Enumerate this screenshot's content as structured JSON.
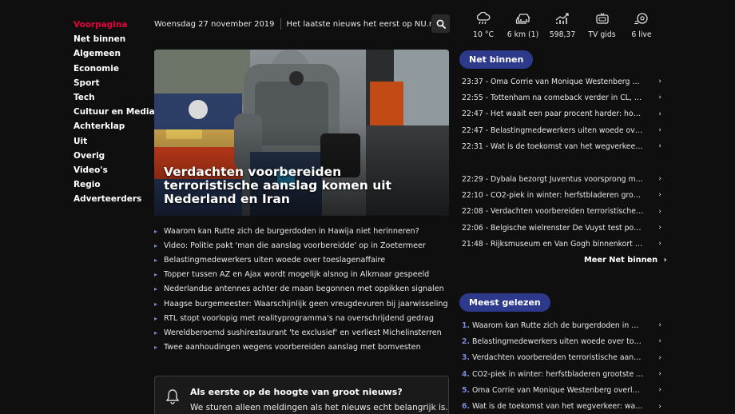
{
  "nav": {
    "items": [
      {
        "label": "Voorpagina",
        "active": true
      },
      {
        "label": "Net binnen",
        "active": false
      },
      {
        "label": "Algemeen",
        "active": false
      },
      {
        "label": "Economie",
        "active": false
      },
      {
        "label": "Sport",
        "active": false
      },
      {
        "label": "Tech",
        "active": false
      },
      {
        "label": "Cultuur en Media",
        "active": false
      },
      {
        "label": "Achterklap",
        "active": false
      },
      {
        "label": "Uit",
        "active": false
      },
      {
        "label": "Overig",
        "active": false
      },
      {
        "label": "Video's",
        "active": false
      },
      {
        "label": "Regio",
        "active": false
      },
      {
        "label": "Adverteerders",
        "active": false
      }
    ]
  },
  "topbar": {
    "date": "Woensdag 27 november 2019",
    "tagline": "Het laatste nieuws het eerst op NU.nl",
    "search_icon": "search-icon"
  },
  "widgets": [
    {
      "icon": "weather-rain-icon",
      "label": "10 °C"
    },
    {
      "icon": "traffic-car-icon",
      "label": "6 km (1)"
    },
    {
      "icon": "stock-chart-icon",
      "label": "598,37"
    },
    {
      "icon": "tv-icon",
      "label": "TV gids"
    },
    {
      "icon": "soccer-ball-icon",
      "label": "6 live"
    }
  ],
  "hero": {
    "title": "Verdachten voorbereiden terroristische aanslag komen uit Nederland en Iran"
  },
  "headlines": [
    "Waarom kan Rutte zich de burgerdoden in Hawija niet herinneren?",
    "Video: Politie pakt 'man die aanslag voorbereidde' op in Zoetermeer",
    "Belastingmedewerkers uiten woede over toeslagenaffaire",
    "Topper tussen AZ en Ajax wordt mogelijk alsnog in Alkmaar gespeeld",
    "Nederlandse antennes achter de maan begonnen met oppikken signalen",
    "Haagse burgemeester: Waarschijnlijk geen vreugdevuren bij jaarwisseling",
    "RTL stopt voorlopig met realityprogramma's na overschrijdend gedrag",
    "Wereldberoemd sushirestaurant 'te exclusief' en verliest Michelinsterren",
    "Twee aanhoudingen wegens voorbereiden aanslag met bomvesten"
  ],
  "notify": {
    "title": "Als eerste op de hoogte van groot nieuws?",
    "subtitle": "We sturen alleen meldingen als het nieuws echt belangrijk is."
  },
  "net_binnen": {
    "title": "Net binnen",
    "group1": [
      "23:37 - Oma Corrie van Monique Westenberg ov...",
      "22:55 - Tottenham na comeback verder in CL, oo...",
      "22:47 - Het waait een paar procent harder: hoger...",
      "22:47 - Belastingmedewerkers uiten woede over ...",
      "22:31 - Wat is de toekomst van het wegverkeer: ..."
    ],
    "group2": [
      "22:29 - Dybala bezorgt Juventus voorsprong met ...",
      "22:10 - CO2-piek in winter: herfstbladeren groots...",
      "22:08 - Verdachten voorbereiden terroristische a...",
      "22:06 - Belgische wielrenster De Vuyst test positi...",
      "21:48 - Rijksmuseum en Van Gogh binnenkort éé..."
    ],
    "more_label": "Meer Net binnen"
  },
  "meest_gelezen": {
    "title": "Meest gelezen",
    "items": [
      {
        "num": "1.",
        "text": "Waarom kan Rutte zich de burgerdoden in Ha..."
      },
      {
        "num": "2.",
        "text": "Belastingmedewerkers uiten woede over toes..."
      },
      {
        "num": "3.",
        "text": "Verdachten voorbereiden terroristische aansl..."
      },
      {
        "num": "4.",
        "text": "CO2-piek in winter: herfstbladeren grootste 'v..."
      },
      {
        "num": "5.",
        "text": "Oma Corrie van Monique Westenberg overled..."
      },
      {
        "num": "6.",
        "text": "Wat is de toekomst van het wegverkeer: wate..."
      }
    ]
  },
  "colors": {
    "accent": "#e6003c",
    "pill": "#2d3a8c",
    "link_chevron": "#7a87d8",
    "background": "#0f0f0f"
  }
}
